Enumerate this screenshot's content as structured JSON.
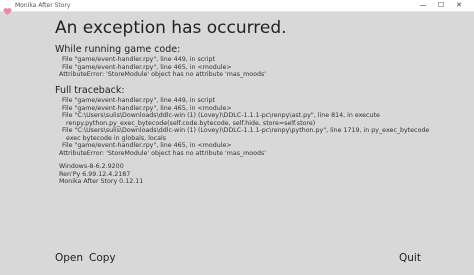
{
  "window": {
    "title": "Monika After Story",
    "icon": "heart-icon",
    "minimize_glyph": "—",
    "maximize_glyph": "☐",
    "close_glyph": "✕"
  },
  "error": {
    "heading": "An exception has occurred.",
    "game_code_title": "While running game code:",
    "game_code_lines": [
      "File \"game/event-handler.rpy\", line 449, in script",
      "File \"game/event-handler.rpy\", line 465, in <module>",
      "AttributeError: 'StoreModule' object has no attribute 'mas_moods'"
    ],
    "traceback_title": "Full traceback:",
    "traceback_lines": [
      "File \"game/event-handler.rpy\", line 449, in script",
      "File \"game/event-handler.rpy\", line 465, in <module>",
      "File \"C:\\Users\\sulis\\Downloads\\ddlc-win (1) (Lovey)\\DDLC-1.1.1-pc\\renpy\\ast.py\", line 814, in execute",
      "renpy.python.py_exec_bytecode(self.code.bytecode, self.hide, store=self.store)",
      "File \"C:\\Users\\sulis\\Downloads\\ddlc-win (1) (Lovey)\\DDLC-1.1.1-pc\\renpy\\python.py\", line 1719, in py_exec_bytecode",
      "exec bytecode in globals, locals",
      "File \"game/event-handler.rpy\", line 465, in <module>",
      "AttributeError: 'StoreModule' object has no attribute 'mas_moods'"
    ],
    "system_lines": [
      "Windows-8-6.2.9200",
      "Ren'Py 6.99.12.4.2187",
      "Monika After Story 0.12.11"
    ]
  },
  "buttons": {
    "open": "Open",
    "copy": "Copy",
    "quit": "Quit"
  }
}
